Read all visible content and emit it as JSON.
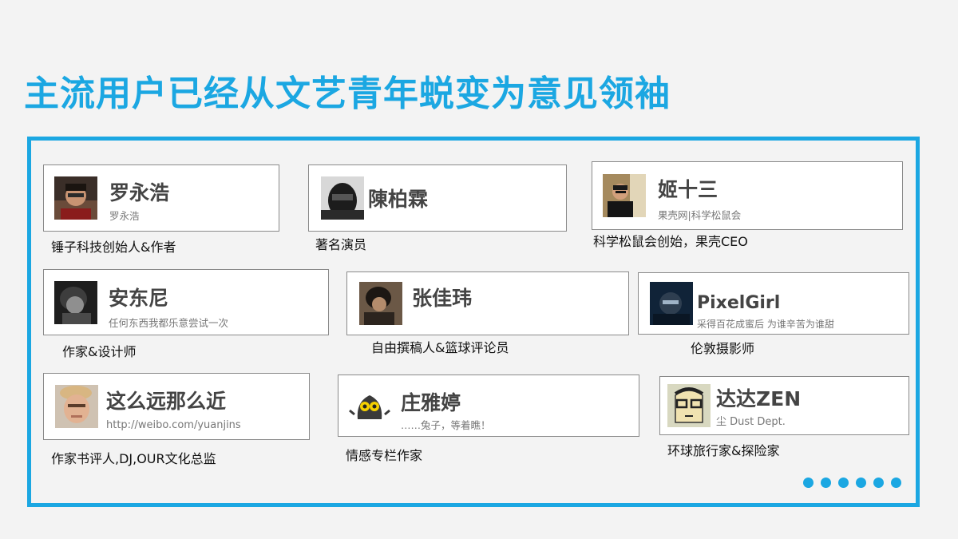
{
  "slide": {
    "title": "主流用户已经从文艺青年蜕变为意见领袖"
  },
  "profiles": [
    {
      "name": "罗永浩",
      "sub": "罗永浩",
      "caption": "锤子科技创始人&作者",
      "avatar": "avatar-photo"
    },
    {
      "name": "陳柏霖",
      "sub": "",
      "caption": "著名演员",
      "avatar": "avatar-photo"
    },
    {
      "name": "姬十三",
      "sub": "果壳网|科学松鼠会",
      "caption": "科学松鼠会创始，果壳CEO",
      "avatar": "avatar-photo"
    },
    {
      "name": "安东尼",
      "sub": "任何东西我都乐意尝试一次",
      "caption": "作家&设计师",
      "avatar": "avatar-photo"
    },
    {
      "name": "张佳玮",
      "sub": "",
      "caption": "自由撰稿人&篮球评论员",
      "avatar": "avatar-photo"
    },
    {
      "name": "PixelGirl",
      "sub": "采得百花成蜜后 为谁辛苦为谁甜",
      "caption": "伦敦摄影师",
      "avatar": "avatar-photo"
    },
    {
      "name": "这么远那么近",
      "sub": "http://weibo.com/yuanjins",
      "caption": "作家书评人,DJ,OUR文化总监",
      "avatar": "avatar-photo"
    },
    {
      "name": "庄雅婷",
      "sub": "……兔子，等着瞧！",
      "caption": "情感专栏作家",
      "avatar": "avatar-cartoon"
    },
    {
      "name": "达达ZEN",
      "sub": "尘 Dust Dept.",
      "caption": "环球旅行家&探险家",
      "avatar": "avatar-drawing"
    }
  ],
  "colors": {
    "accent": "#1ba7e2",
    "card_border": "#8a8a8a",
    "background": "#f3f3f3"
  },
  "carousel": {
    "dot_count": 6,
    "icon": "dots-indicator-icon"
  }
}
